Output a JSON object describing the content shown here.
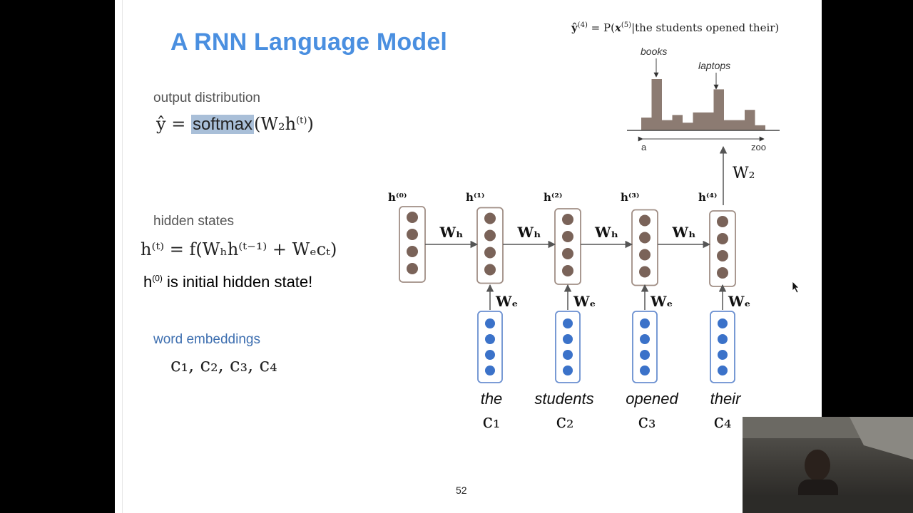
{
  "slide": {
    "title": "A RNN Language Model",
    "page_number": "52",
    "top_equation": {
      "lhs": "ŷ",
      "lhs_sup": "(4)",
      "mid": " = P(",
      "x": "x",
      "x_sup": "(5)",
      "cond": "|the students opened their)"
    },
    "output_distribution": {
      "label": "output distribution",
      "eq_prefix": "ŷ = ",
      "softmax": "softmax",
      "eq_suffix": "(W₂h",
      "sup": "(t)",
      "close": ")"
    },
    "hidden_states": {
      "label": "hidden states",
      "eq": "h⁽ᵗ⁾ = f(Wₕh⁽ᵗ⁻¹⁾ + Wₑcₜ)",
      "note_prefix": "h",
      "note_sup": "(0)",
      "note_suffix": " is initial hidden state!"
    },
    "word_embeddings": {
      "label": "word embeddings",
      "eq": "c₁, c₂, c₃, c₄"
    },
    "diagram": {
      "hidden_labels": [
        "h⁽⁰⁾",
        "h⁽¹⁾",
        "h⁽²⁾",
        "h⁽³⁾",
        "h⁽⁴⁾"
      ],
      "recurrent_weight": "Wₕ",
      "embedding_weight": "Wₑ",
      "output_weight": "W₂",
      "words": [
        "the",
        "students",
        "opened",
        "their"
      ],
      "embedding_vars": [
        "c₁",
        "c₂",
        "c₃",
        "c₄"
      ],
      "histogram": {
        "label_books": "books",
        "label_laptops": "laptops",
        "axis_start": "a",
        "axis_end": "zoo",
        "values": [
          0.25,
          1.0,
          0.2,
          0.3,
          0.15,
          0.35,
          0.35,
          0.8,
          0.2,
          0.2,
          0.4,
          0.1
        ],
        "bar_color": "#8c7b72"
      },
      "hidden_color": "#7a6359",
      "embed_color": "#3b72c9"
    }
  }
}
